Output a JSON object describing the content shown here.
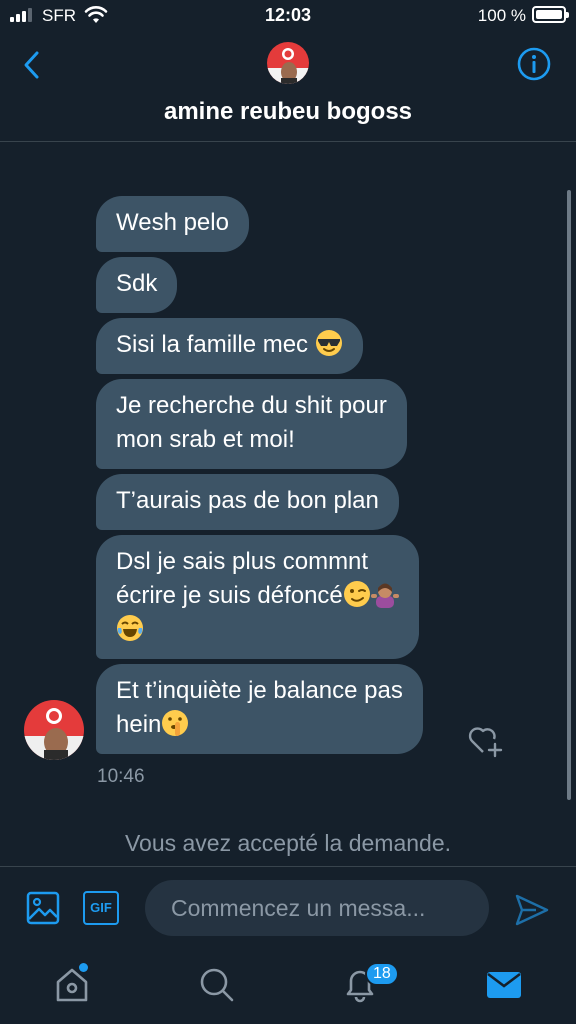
{
  "status_bar": {
    "carrier": "SFR",
    "time": "12:03",
    "battery": "100 %",
    "battery_level": 1.0
  },
  "header": {
    "contact_name": "amine reubeu bogoss",
    "back_icon": "chevron-left-icon",
    "info_icon": "info-icon"
  },
  "messages": [
    {
      "text": "Wesh pelo",
      "emoji": []
    },
    {
      "text": "Sdk",
      "emoji": []
    },
    {
      "text": "Sisi la famille mec ",
      "emoji": [
        "sunglasses-emoji"
      ]
    },
    {
      "text": "Je recherche du shit pour\nmon srab et moi!",
      "emoji": []
    },
    {
      "text": "T’aurais pas de bon plan",
      "emoji": []
    },
    {
      "text": "Dsl je sais plus commnt\nécrire je suis défoncé",
      "emoji": [
        "wink-emoji",
        "shrug-emoji",
        "joy-emoji"
      ]
    },
    {
      "text": "Et t’inquiète je balance pas\nhein",
      "emoji": [
        "shushing-emoji"
      ]
    }
  ],
  "last_message_time": "10:46",
  "request_note": "Vous avez accepté la demande.",
  "composer": {
    "placeholder": "Commencez un messa...",
    "gif_label": "GIF"
  },
  "tab_bar": {
    "tabs": [
      "home-icon",
      "search-icon",
      "bell-icon",
      "mail-icon"
    ],
    "notifications_badge": "18",
    "active_tab": "mail-icon"
  },
  "colors": {
    "background": "#15202b",
    "bubble": "#3d5466",
    "accent": "#1d9bf0",
    "muted_text": "#8b98a5"
  }
}
